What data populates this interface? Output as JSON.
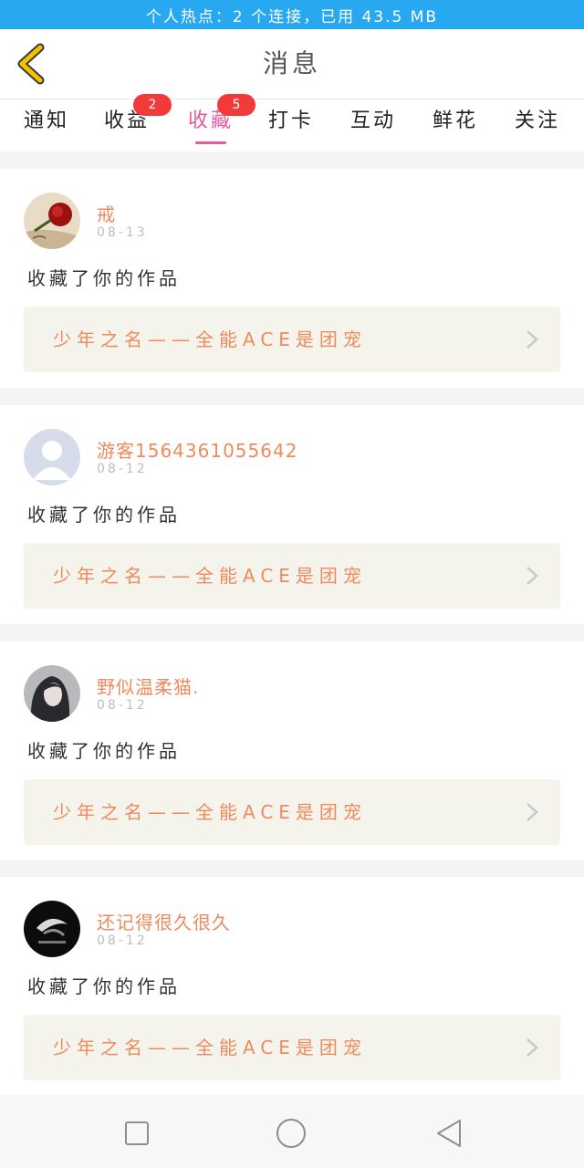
{
  "status_bar": {
    "text": "个人热点：2 个连接，已用 43.5 MB"
  },
  "header": {
    "title": "消息",
    "back_icon": "chevron-left-icon",
    "back_color": "#f2c200"
  },
  "tabs": [
    {
      "label": "通知",
      "badge": "",
      "active": false
    },
    {
      "label": "收益",
      "badge": "2",
      "active": false
    },
    {
      "label": "收藏",
      "badge": "5",
      "active": true
    },
    {
      "label": "打卡",
      "badge": "",
      "active": false
    },
    {
      "label": "互动",
      "badge": "",
      "active": false
    },
    {
      "label": "鲜花",
      "badge": "",
      "active": false
    },
    {
      "label": "关注",
      "badge": "",
      "active": false
    }
  ],
  "messages": [
    {
      "username": "戒",
      "date": "08-13",
      "action": "收藏了你的作品",
      "work_title": "少年之名——全能ACE是团宠",
      "avatar": "rose-photo-avatar"
    },
    {
      "username": "游客15643610556​42",
      "date": "08-12",
      "action": "收藏了你的作品",
      "work_title": "少年之名——全能ACE是团宠",
      "avatar": "default-user-avatar"
    },
    {
      "username": "野似温柔猫.",
      "date": "08-12",
      "action": "收藏了你的作品",
      "work_title": "少年之名——全能ACE是团宠",
      "avatar": "girl-photo-avatar"
    },
    {
      "username": "还记得很久很久",
      "date": "08-12",
      "action": "收藏了你的作品",
      "work_title": "少年之名——全能ACE是团宠",
      "avatar": "dark-photo-avatar"
    }
  ],
  "nav_bar": {
    "icons": [
      "recent-apps-icon",
      "home-icon",
      "back-triangle-icon"
    ]
  },
  "colors": {
    "accent": "#e75a9b",
    "status_bar": "#29a8f2",
    "username": "#f08a5d",
    "badge": "#f23a3a"
  }
}
